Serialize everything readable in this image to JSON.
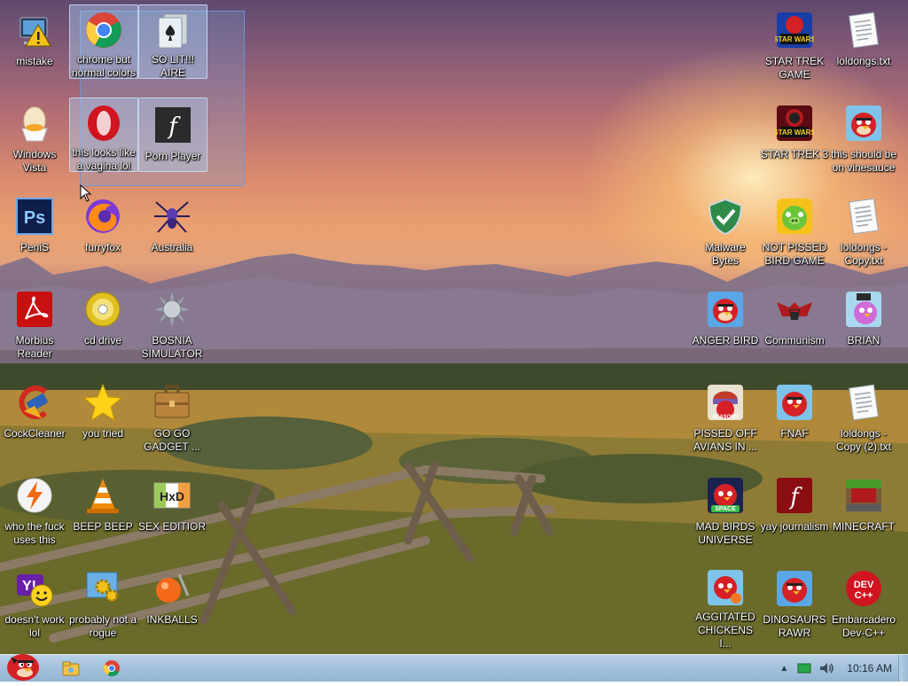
{
  "desktop": {
    "icons": {
      "mistake": "mistake",
      "chrome": "chrome but normal colors",
      "solit": "SO LIT!!! AIRE",
      "startrek_game": "STAR TREK GAME",
      "loldongs": "loldongs.txt",
      "windows_vista": "Windows Vista",
      "opera": "this looks like a vagina lol",
      "porn_player": "Porn Player",
      "startrek3": "STAR TREK 3",
      "vinesauce": "this should be on vinesauce",
      "penis": "PeniS",
      "furryfox": "furryfox",
      "australia": "Australia",
      "malware": "Malware Bytes",
      "not_pissed": "NOT PISSED BIRD GAME",
      "loldongs_copy": "loldongs - Copy.txt",
      "morbius": "Morbius Reader",
      "cd_drive": "cd drive",
      "bosnia": "BOSNIA SIMULATOR",
      "anger_bird": "ANGER BIRD",
      "communism": "Communism",
      "brian": "BRIAN",
      "cockcleaner": "CockCleaner",
      "you_tried": "you tried",
      "gogo": "GO GO GADGET ...",
      "pissed_off": "PISSED OFF AVIANS IN ...",
      "fnaf": "FNAF",
      "loldongs_copy2": "loldongs - Copy (2).txt",
      "who_uses": "who the fuck uses this",
      "beep": "BEEP BEEP",
      "sex_editior": "SEX EDITIOR",
      "mad_birds": "MAD BIRDS UNIVERSE",
      "yay_journalism": "yay journalism",
      "minecraft": "MINECRAFT",
      "doesnt_work": "doesn't work lol",
      "probably_not": "probably not a rogue",
      "inkballs": "INKBALLS",
      "aggitated": "AGGITATED CHICKENS I...",
      "dinosaurs": "DINOSAURS RAWR",
      "embarcadero": "Embarcadero Dev-C++"
    }
  },
  "taskbar": {
    "clock": "10:16 AM"
  },
  "colors": {
    "taskbar": "#a4c2dc",
    "selection": "#aacdf0"
  }
}
